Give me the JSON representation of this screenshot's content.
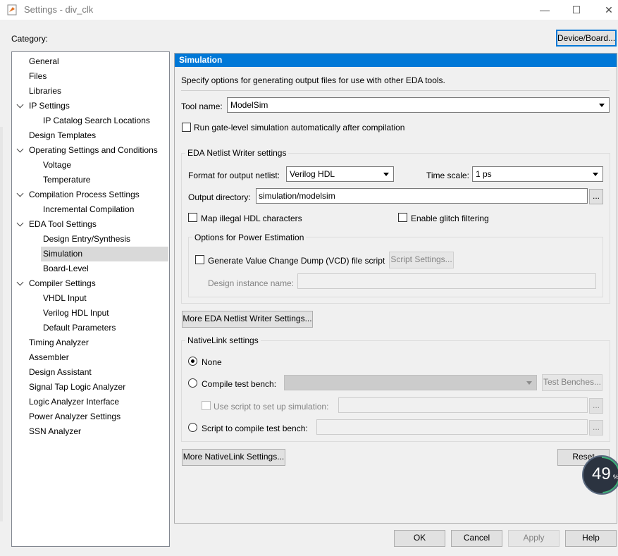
{
  "window": {
    "title": "Settings - div_clk",
    "minimize": "—",
    "maximize": "☐",
    "close": "✕"
  },
  "category_label": "Category:",
  "device_board_button": "Device/Board...",
  "tree": [
    {
      "label": "General",
      "level": 0,
      "expand": false
    },
    {
      "label": "Files",
      "level": 0,
      "expand": false
    },
    {
      "label": "Libraries",
      "level": 0,
      "expand": false
    },
    {
      "label": "IP Settings",
      "level": 0,
      "expand": true
    },
    {
      "label": "IP Catalog Search Locations",
      "level": 1,
      "expand": false
    },
    {
      "label": "Design Templates",
      "level": 0,
      "expand": false
    },
    {
      "label": "Operating Settings and Conditions",
      "level": 0,
      "expand": true
    },
    {
      "label": "Voltage",
      "level": 1,
      "expand": false
    },
    {
      "label": "Temperature",
      "level": 1,
      "expand": false
    },
    {
      "label": "Compilation Process Settings",
      "level": 0,
      "expand": true
    },
    {
      "label": "Incremental Compilation",
      "level": 1,
      "expand": false
    },
    {
      "label": "EDA Tool Settings",
      "level": 0,
      "expand": true
    },
    {
      "label": "Design Entry/Synthesis",
      "level": 1,
      "expand": false
    },
    {
      "label": "Simulation",
      "level": 1,
      "expand": false,
      "selected": true
    },
    {
      "label": "Board-Level",
      "level": 1,
      "expand": false
    },
    {
      "label": "Compiler Settings",
      "level": 0,
      "expand": true
    },
    {
      "label": "VHDL Input",
      "level": 1,
      "expand": false
    },
    {
      "label": "Verilog HDL Input",
      "level": 1,
      "expand": false
    },
    {
      "label": "Default Parameters",
      "level": 1,
      "expand": false
    },
    {
      "label": "Timing Analyzer",
      "level": 0,
      "expand": false
    },
    {
      "label": "Assembler",
      "level": 0,
      "expand": false
    },
    {
      "label": "Design Assistant",
      "level": 0,
      "expand": false
    },
    {
      "label": "Signal Tap Logic Analyzer",
      "level": 0,
      "expand": false
    },
    {
      "label": "Logic Analyzer Interface",
      "level": 0,
      "expand": false
    },
    {
      "label": "Power Analyzer Settings",
      "level": 0,
      "expand": false
    },
    {
      "label": "SSN Analyzer",
      "level": 0,
      "expand": false
    }
  ],
  "panel": {
    "header": "Simulation",
    "description": "Specify options for generating output files for use with other EDA tools.",
    "tool_name_label": "Tool name:",
    "tool_name_value": "ModelSim",
    "run_gate_level": "Run gate-level simulation automatically after compilation",
    "eda_netlist": {
      "title": "EDA Netlist Writer settings",
      "format_label": "Format for output netlist:",
      "format_value": "Verilog HDL",
      "time_scale_label": "Time scale:",
      "time_scale_value": "1 ps",
      "output_dir_label": "Output directory:",
      "output_dir_value": "simulation/modelsim",
      "browse": "...",
      "map_illegal": "Map illegal HDL characters",
      "enable_glitch": "Enable glitch filtering",
      "power": {
        "title": "Options for Power Estimation",
        "vcd": "Generate Value Change Dump (VCD) file script",
        "script_settings": "Script Settings...",
        "design_instance_label": "Design instance name:",
        "design_instance_value": ""
      }
    },
    "more_eda_button": "More EDA Netlist Writer Settings...",
    "nativelink": {
      "title": "NativeLink settings",
      "none": "None",
      "compile_tb": "Compile test bench:",
      "compile_tb_value": "",
      "test_benches": "Test Benches...",
      "use_script": "Use script to set up simulation:",
      "script_compile": "Script to compile test bench:",
      "browse": "..."
    },
    "more_nativelink_button": "More NativeLink Settings...",
    "reset_button": "Reset"
  },
  "footer": {
    "ok": "OK",
    "cancel": "Cancel",
    "apply": "Apply",
    "help": "Help"
  },
  "overlay_badge": {
    "value": "49",
    "unit": "%"
  },
  "colors": {
    "accent": "#0078d7",
    "selection": "#d9d9d9"
  }
}
